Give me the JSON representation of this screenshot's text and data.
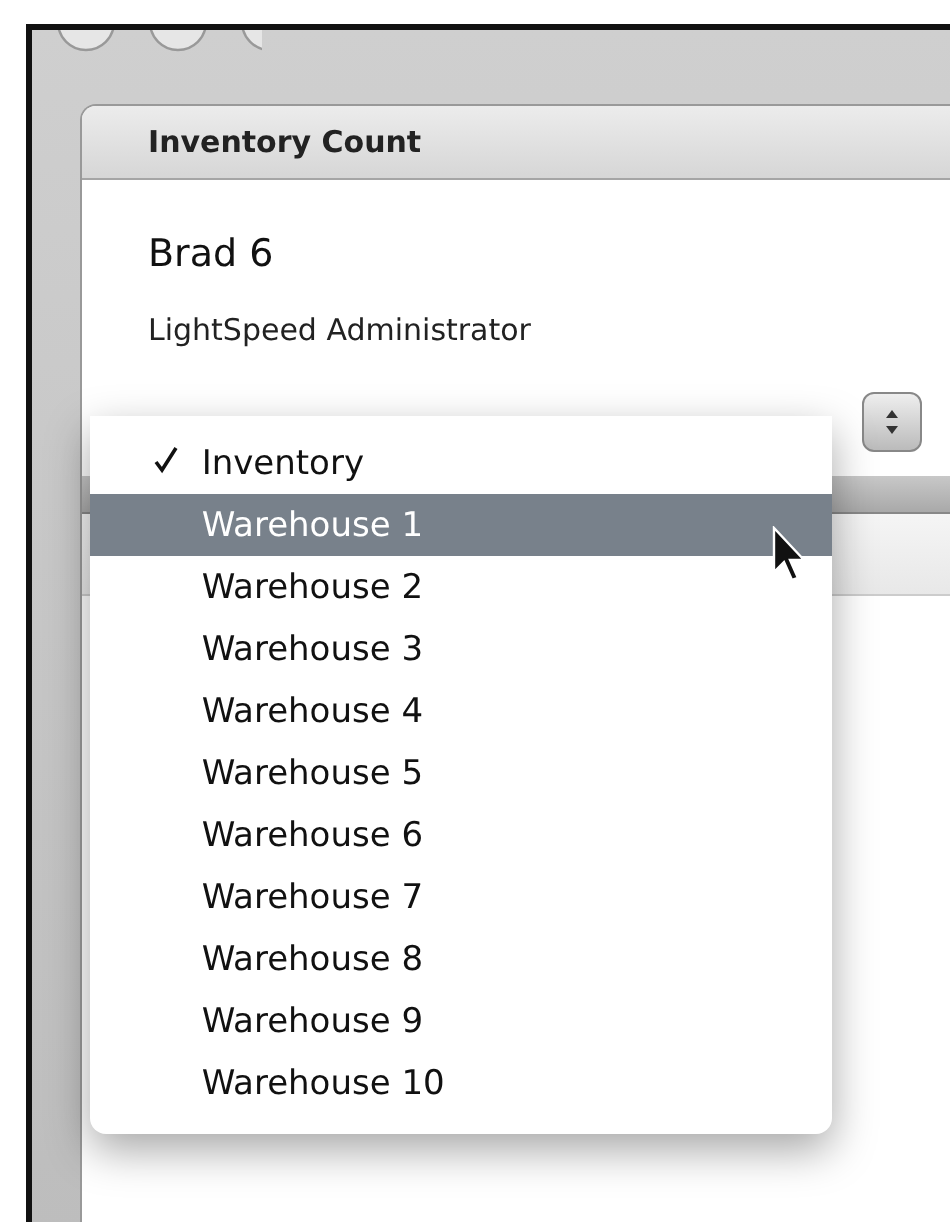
{
  "panel": {
    "title": "Inventory Count",
    "name": "Brad 6",
    "role": "LightSpeed Administrator"
  },
  "location_menu": {
    "options": [
      {
        "label": "Inventory",
        "checked": true,
        "selected": false
      },
      {
        "label": "Warehouse 1",
        "checked": false,
        "selected": true
      },
      {
        "label": "Warehouse 2",
        "checked": false,
        "selected": false
      },
      {
        "label": "Warehouse 3",
        "checked": false,
        "selected": false
      },
      {
        "label": "Warehouse 4",
        "checked": false,
        "selected": false
      },
      {
        "label": "Warehouse 5",
        "checked": false,
        "selected": false
      },
      {
        "label": "Warehouse 6",
        "checked": false,
        "selected": false
      },
      {
        "label": "Warehouse 7",
        "checked": false,
        "selected": false
      },
      {
        "label": "Warehouse 8",
        "checked": false,
        "selected": false
      },
      {
        "label": "Warehouse 9",
        "checked": false,
        "selected": false
      },
      {
        "label": "Warehouse 10",
        "checked": false,
        "selected": false
      }
    ]
  }
}
